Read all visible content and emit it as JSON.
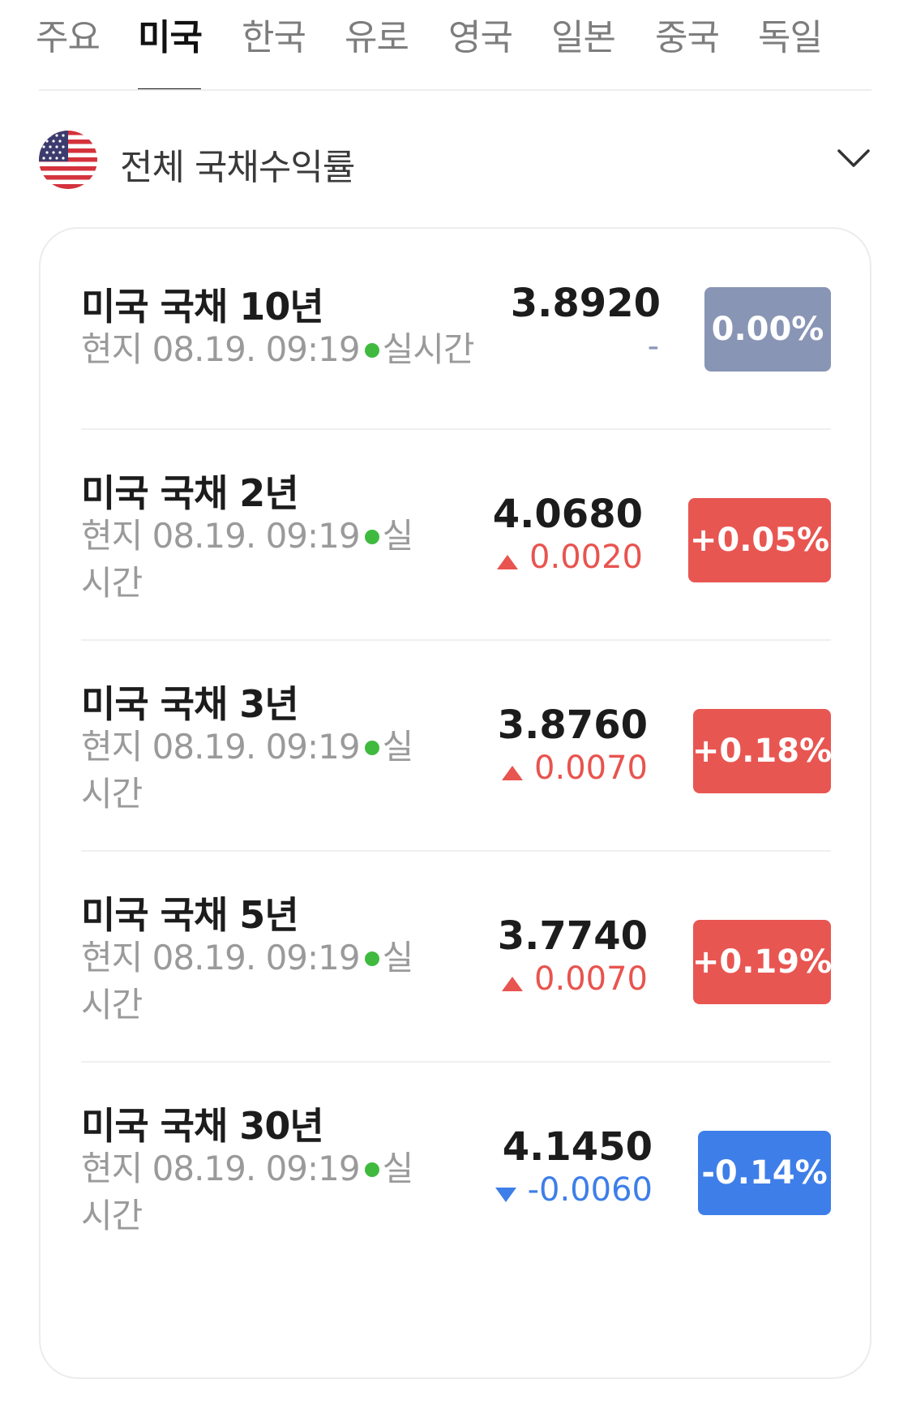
{
  "tabs": [
    {
      "label": "주요"
    },
    {
      "label": "미국"
    },
    {
      "label": "한국"
    },
    {
      "label": "유로"
    },
    {
      "label": "영국"
    },
    {
      "label": "일본"
    },
    {
      "label": "중국"
    },
    {
      "label": "독일"
    }
  ],
  "active_tab": "미국",
  "section": {
    "title": "전체 국채수익률",
    "flag_icon": "us-flag-icon",
    "expand_icon": "chevron-down-icon"
  },
  "bonds": [
    {
      "name": "미국 국채 10년",
      "local_label": "현지",
      "datetime": "08.19. 09:19",
      "live_label": "실시간",
      "value": "3.8920",
      "change": "-",
      "change_direction": "flat",
      "percent": "0.00%"
    },
    {
      "name": "미국 국채 2년",
      "local_label": "현지",
      "datetime": "08.19. 09:19",
      "live_label": "실시간",
      "value": "4.0680",
      "change": "0.0020",
      "change_direction": "up",
      "percent": "+0.05%"
    },
    {
      "name": "미국 국채 3년",
      "local_label": "현지",
      "datetime": "08.19. 09:19",
      "live_label": "실시간",
      "value": "3.8760",
      "change": "0.0070",
      "change_direction": "up",
      "percent": "+0.18%"
    },
    {
      "name": "미국 국채 5년",
      "local_label": "현지",
      "datetime": "08.19. 09:19",
      "live_label": "실시간",
      "value": "3.7740",
      "change": "0.0070",
      "change_direction": "up",
      "percent": "+0.19%"
    },
    {
      "name": "미국 국채 30년",
      "local_label": "현지",
      "datetime": "08.19. 09:19",
      "live_label": "실시간",
      "value": "4.1450",
      "change": "-0.0060",
      "change_direction": "down",
      "percent": "-0.14%"
    }
  ],
  "colors": {
    "up": "#e85652",
    "down": "#3e7ee8",
    "flat": "#8895b5",
    "live": "#3fba3f"
  }
}
